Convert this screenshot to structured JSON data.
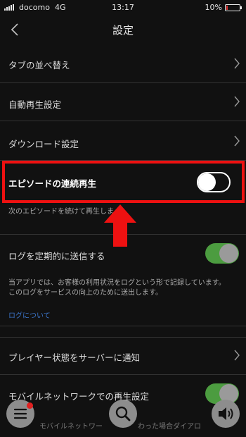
{
  "status_bar": {
    "carrier": "docomo",
    "network": "4G",
    "time": "13:17",
    "battery": "10%",
    "battery_level": 0.1
  },
  "header": {
    "title": "設定"
  },
  "settings": {
    "tab_order": "タブの並べ替え",
    "autoplay": "自動再生設定",
    "download": "ダウンロード設定",
    "continuous_play": "エピソードの連続再生",
    "continuous_play_on": false,
    "continuous_play_help": "次のエピソードを続けて再生しま",
    "send_logs": "ログを定期的に送信する",
    "send_logs_on": true,
    "send_logs_help_line1": "当アプリでは、お客様の利用状況をログという形で記録しています。",
    "send_logs_help_line2": "このログをサービスの向上のために送出します。",
    "logs_link": "ログについて",
    "player_state": "プレイヤー状態をサーバーに通知",
    "mobile_playback": "モバイルネットワークでの再生設定",
    "mobile_playback_on": true,
    "mobile_playback_help": "モバイルネットワー　　　　　わった場合ダイアロ"
  },
  "colors": {
    "highlight": "#ee1111",
    "toggle_on": "#4c9c40",
    "link": "#3b74c8"
  },
  "icons": [
    "back-chevron-icon",
    "chevron-right-icon",
    "menu-icon",
    "search-icon",
    "speaker-icon",
    "up-arrow-icon"
  ]
}
